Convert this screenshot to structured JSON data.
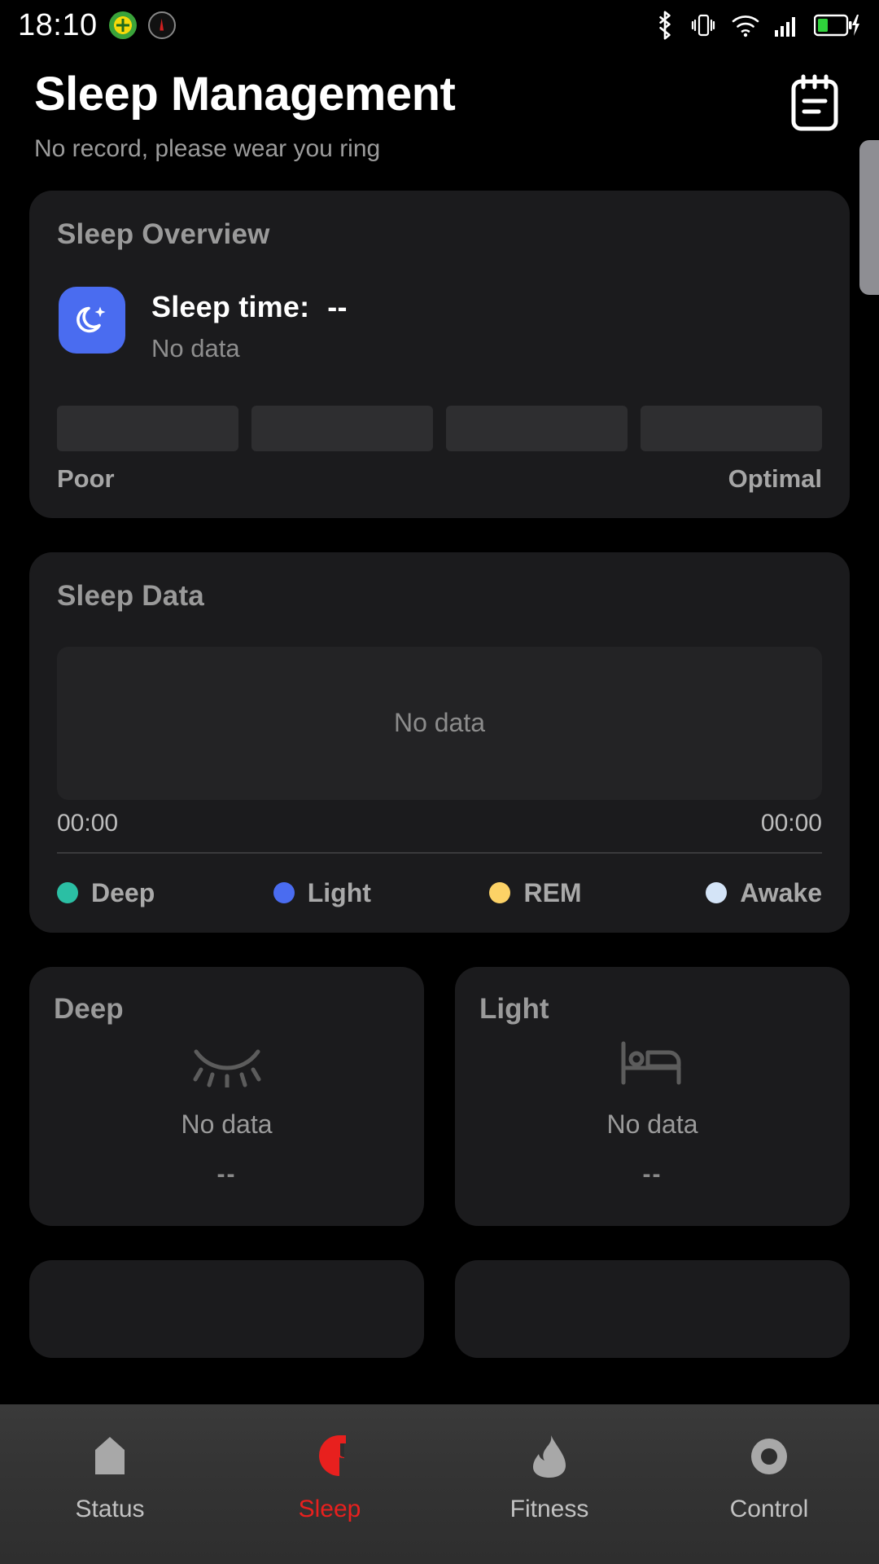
{
  "statusbar": {
    "time": "18:10",
    "left_icons": [
      "app-badge-icon",
      "compass-icon"
    ],
    "right_icons": [
      "bluetooth-icon",
      "vibrate-icon",
      "wifi-icon",
      "cellular-signal-icon",
      "battery-charging-icon"
    ]
  },
  "header": {
    "title": "Sleep Management",
    "subtitle": "No record, please wear you ring",
    "action_icon": "notes-clipboard-icon"
  },
  "overview": {
    "title": "Sleep Overview",
    "icon": "moon-star-icon",
    "icon_color": "#4a6cf0",
    "sleep_time_label": "Sleep time:",
    "sleep_time_value": "--",
    "status": "No data",
    "quality_segments": 4,
    "scale_low": "Poor",
    "scale_high": "Optimal"
  },
  "sleep_data": {
    "title": "Sleep Data",
    "chart_empty": "No data",
    "axis_start": "00:00",
    "axis_end": "00:00",
    "legend": [
      {
        "label": "Deep",
        "color": "#2bbfa4"
      },
      {
        "label": "Light",
        "color": "#4a6cf0"
      },
      {
        "label": "REM",
        "color": "#fcd266"
      },
      {
        "label": "Awake",
        "color": "#d4e4f7"
      }
    ]
  },
  "stage_cards": [
    {
      "title": "Deep",
      "icon": "closed-eye-icon",
      "status": "No data",
      "value": "--"
    },
    {
      "title": "Light",
      "icon": "bed-icon",
      "status": "No data",
      "value": "--"
    }
  ],
  "bottom_nav": {
    "active_color": "#e8201e",
    "items": [
      {
        "label": "Status",
        "icon": "home-icon",
        "active": false
      },
      {
        "label": "Sleep",
        "icon": "moon-icon",
        "active": true
      },
      {
        "label": "Fitness",
        "icon": "flame-icon",
        "active": false
      },
      {
        "label": "Control",
        "icon": "ring-icon",
        "active": false
      }
    ]
  }
}
